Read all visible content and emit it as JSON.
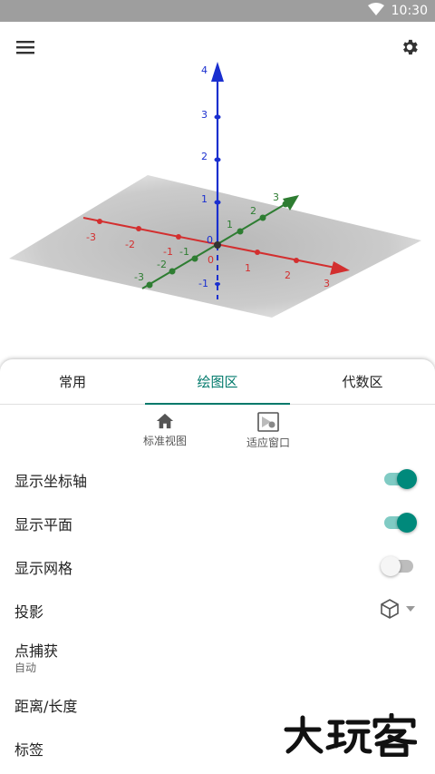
{
  "status_bar": {
    "time": "10:30",
    "wifi_icon": "wifi-icon"
  },
  "toolbar": {
    "menu_icon": "menu-icon",
    "settings_icon": "gear-icon"
  },
  "graphics": {
    "axes": {
      "x": {
        "color": "#d32f2f",
        "ticks": [
          "-3",
          "-2",
          "-1",
          "0",
          "1",
          "2",
          "3"
        ]
      },
      "y": {
        "color": "#2e7d32",
        "ticks": [
          "-3",
          "-2",
          "-1",
          "0",
          "1",
          "2",
          "3"
        ]
      },
      "z": {
        "color": "#1a2fcf",
        "ticks": [
          "-1",
          "0",
          "1",
          "2",
          "3",
          "4"
        ]
      }
    },
    "origin_label": "0",
    "plane_color": "#bdbdbd"
  },
  "tabs": [
    {
      "label": "常用",
      "active": false
    },
    {
      "label": "绘图区",
      "active": true
    },
    {
      "label": "代数区",
      "active": false
    }
  ],
  "quick_actions": {
    "standard_view": {
      "label": "标准视图",
      "icon": "home-icon"
    },
    "fit_window": {
      "label": "适应窗口",
      "icon": "zoom-to-fit-icon"
    }
  },
  "settings": {
    "show_axes": {
      "label": "显示坐标轴",
      "on": true
    },
    "show_plane": {
      "label": "显示平面",
      "on": true
    },
    "show_grid": {
      "label": "显示网格",
      "on": false
    },
    "projection": {
      "label": "投影",
      "icon": "cube-icon"
    },
    "point_capture": {
      "label": "点捕获",
      "value": "自动"
    },
    "distance": {
      "label": "距离/长度"
    },
    "labels": {
      "label": "标签"
    }
  },
  "watermark": {
    "text": "大玩客"
  },
  "accent_color": "#00897b"
}
